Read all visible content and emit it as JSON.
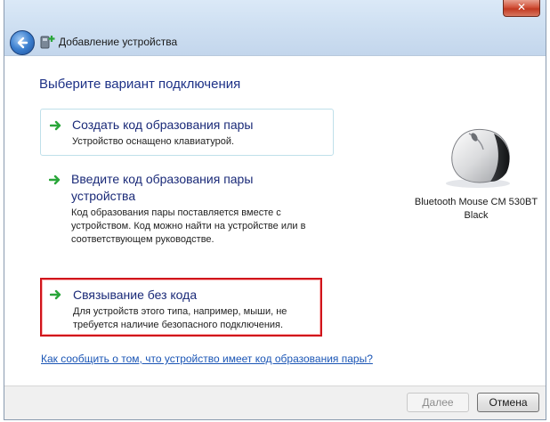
{
  "window": {
    "title": "Добавление устройства",
    "close_glyph": "✕",
    "colors": {
      "accent": "#1e3287",
      "highlight": "#d0141b",
      "link": "#1a55b5"
    }
  },
  "main": {
    "heading": "Выберите вариант подключения",
    "options": [
      {
        "title": "Создать код образования пары",
        "description": "Устройство оснащено клавиатурой.",
        "icon": "green-arrow-icon"
      },
      {
        "title": "Введите код образования пары устройства",
        "description": "Код образования пары поставляется вместе с устройством. Код можно найти на устройстве или в соответствующем руководстве.",
        "icon": "green-arrow-icon"
      },
      {
        "title": "Связывание без кода",
        "description": "Для устройств этого типа, например, мыши, не требуется наличие безопасного подключения.",
        "icon": "green-arrow-icon"
      }
    ],
    "help_link": "Как сообщить о том, что устройство имеет код образования пары?"
  },
  "device": {
    "name": "Bluetooth Mouse CM 530BT Black",
    "icon": "mouse-icon"
  },
  "footer": {
    "next_label": "Далее",
    "cancel_label": "Отмена"
  }
}
